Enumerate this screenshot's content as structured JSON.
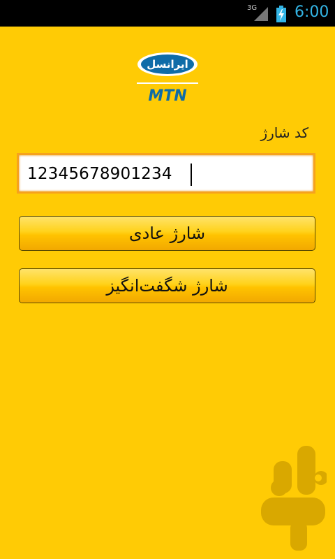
{
  "status_bar": {
    "network": "3G",
    "time": "6:00"
  },
  "logo": {
    "brand_persian": "ایرانسل",
    "brand_latin": "MTN"
  },
  "form": {
    "label": "کد شارژ",
    "code_value": "12345678901234",
    "normal_charge_label": "شارژ عادی",
    "amazing_charge_label": "شارژ شگفت‌انگیز"
  },
  "colors": {
    "background": "#FFCB05",
    "logo_blue": "#0F6CA8",
    "field_border": "#F6A21D",
    "watermark": "#D9A800"
  }
}
